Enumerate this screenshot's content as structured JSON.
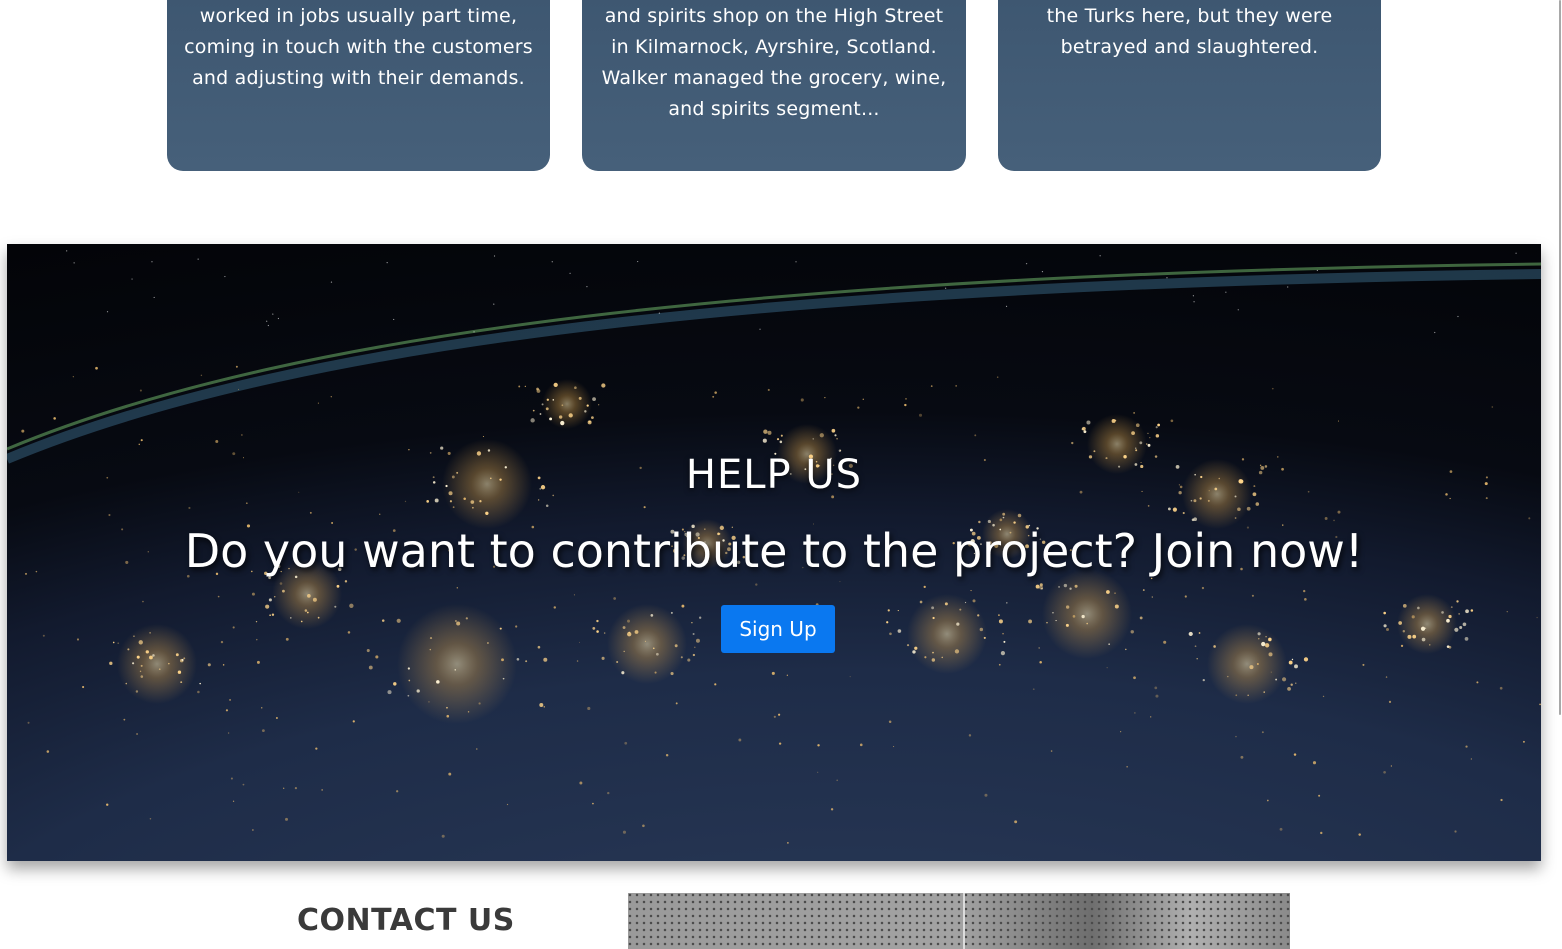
{
  "cards": [
    {
      "text": "worked in jobs usually part time, coming in touch with the customers and adjusting with their demands."
    },
    {
      "text": "and spirits shop on the High Street in Kilmarnock, Ayrshire, Scotland. Walker managed the grocery, wine, and spirits segment..."
    },
    {
      "text": "the Turks here, but they were betrayed and slaughtered."
    }
  ],
  "banner": {
    "title": "HELP US",
    "subtitle": "Do you want to contribute to the project? Join now!",
    "button_label": "Sign Up",
    "image": "earth-at-night-from-space"
  },
  "contact": {
    "title": "CONTACT US",
    "image": "contact-photo"
  },
  "colors": {
    "card_bg": "#425a73",
    "button_bg": "#0a78f0",
    "heading": "#3a3a3a"
  }
}
